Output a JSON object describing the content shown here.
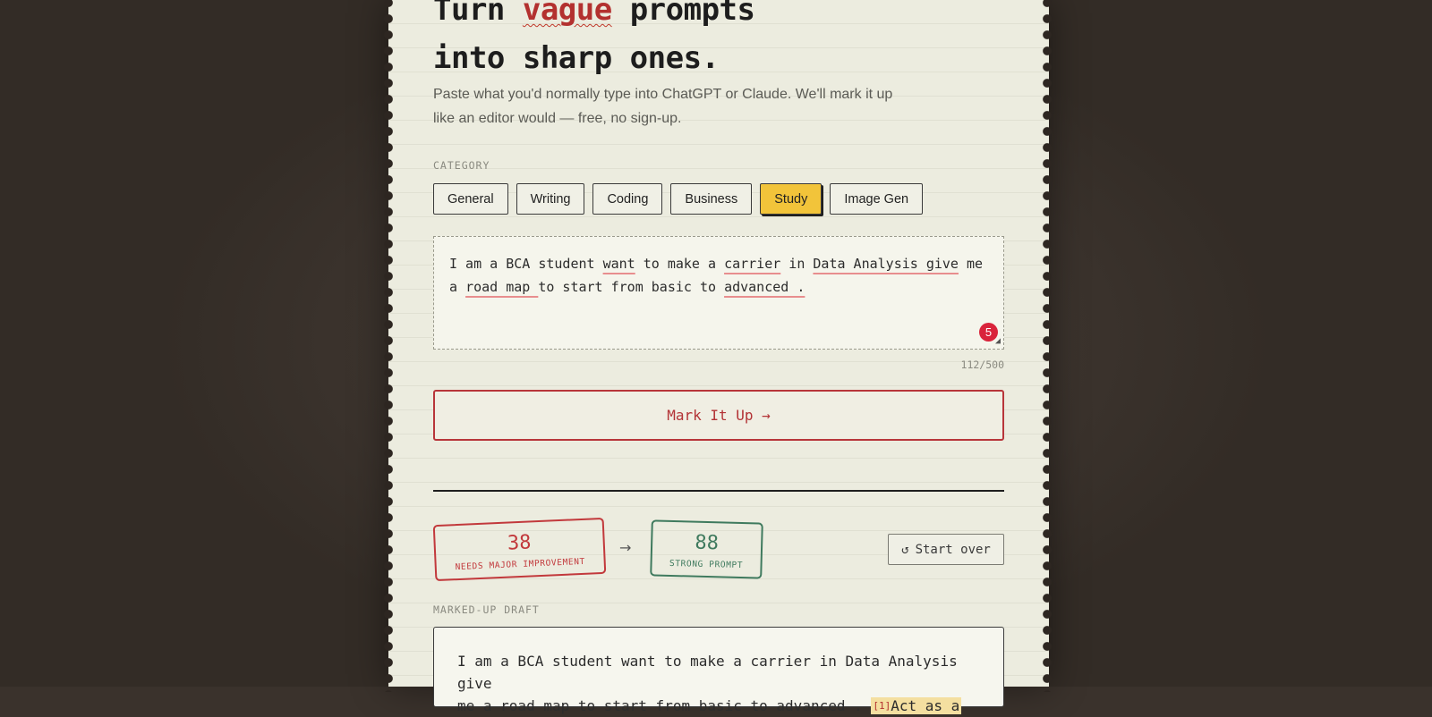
{
  "hero": {
    "headline_pre": "Turn ",
    "headline_emphasis": "vague",
    "headline_post": " prompts",
    "headline_line2": "into sharp ones.",
    "subtitle": "Paste what you'd normally type into ChatGPT or Claude. We'll mark it up like an editor would — free, no sign-up."
  },
  "category": {
    "label": "CATEGORY",
    "options": [
      "General",
      "Writing",
      "Coding",
      "Business",
      "Study",
      "Image Gen"
    ],
    "selected": "Study"
  },
  "editor": {
    "segments": [
      {
        "text": "I am a BCA student ",
        "flagged": false
      },
      {
        "text": "want",
        "flagged": true
      },
      {
        "text": " to make a ",
        "flagged": false
      },
      {
        "text": "carrier",
        "flagged": true
      },
      {
        "text": " in ",
        "flagged": false
      },
      {
        "text": "Data Analysis give",
        "flagged": true
      },
      {
        "text": " me a ",
        "flagged": false
      },
      {
        "text": "road map ",
        "flagged": true
      },
      {
        "text": "to start from basic to ",
        "flagged": false
      },
      {
        "text": "advanced .",
        "flagged": true
      }
    ],
    "issue_count": "5",
    "char_count": "112/500",
    "resize_icon": "resize-handle-icon"
  },
  "actions": {
    "mark_label": "Mark It Up",
    "mark_icon": "→",
    "start_over_icon": "↺",
    "start_over_label": "Start over"
  },
  "scores": {
    "before_score": "38",
    "before_label": "NEEDS MAJOR IMPROVEMENT",
    "arrow": "→",
    "after_score": "88",
    "after_label": "STRONG PROMPT"
  },
  "draft": {
    "label": "MARKED-UP DRAFT",
    "line1": "I am a BCA student want to make a carrier in Data Analysis give",
    "line2_text": "me a road map to start from basic to advanced . ",
    "insert_marker": "[1]",
    "insert_text": "Act as a"
  },
  "colors": {
    "page_bg": "#3a322c",
    "paper": "#ececdf",
    "accent_red": "#b8353a",
    "accent_yellow": "#f2c43a",
    "accent_green": "#3f7a5e",
    "badge": "#d9243b"
  }
}
